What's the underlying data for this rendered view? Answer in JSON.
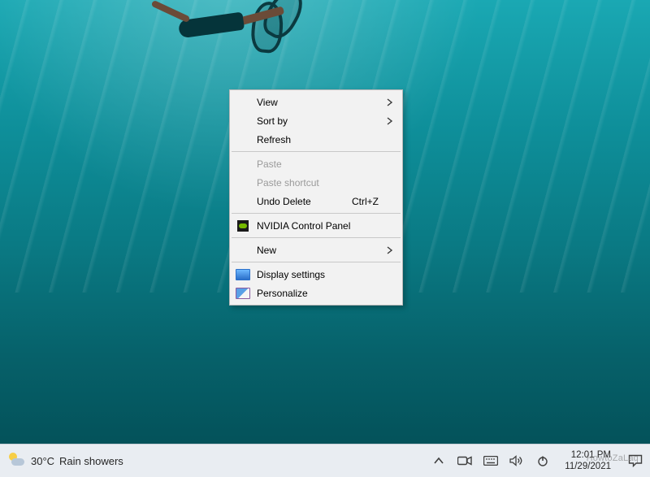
{
  "context_menu": {
    "view": "View",
    "sort_by": "Sort by",
    "refresh": "Refresh",
    "paste": "Paste",
    "paste_shortcut": "Paste shortcut",
    "undo_delete": "Undo Delete",
    "undo_delete_accel": "Ctrl+Z",
    "nvidia": "NVIDIA Control Panel",
    "new": "New",
    "display_settings": "Display settings",
    "personalize": "Personalize"
  },
  "taskbar": {
    "weather_temp": "30°C",
    "weather_desc": "Rain showers",
    "clock_time": "12:01 PM",
    "clock_date": "11/29/2021"
  },
  "watermark": "HowtoZaLaq"
}
